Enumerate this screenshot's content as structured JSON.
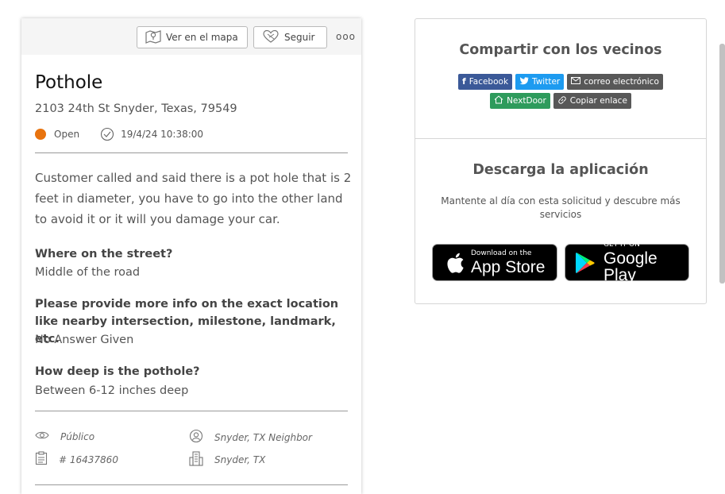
{
  "request": {
    "actions": {
      "map_label": "Ver en el mapa",
      "follow_label": "Seguir",
      "more_label": "ooo"
    },
    "title": "Pothole",
    "address": "2103 24th St Snyder, Texas, 79549",
    "status": {
      "label": "Open",
      "color": "#e8730e"
    },
    "timestamp": "19/4/24 10:38:00",
    "description": "Customer called and said there is a pot hole that is 2 feet in diameter, you have to go into the other land to avoid it or it will you damage your car.",
    "questions": [
      {
        "question": "Where on the street?",
        "answer": "Middle of the road"
      },
      {
        "question": "Please provide more info on the exact location like nearby intersection, milestone, landmark, etc.",
        "answer": "No Answer Given"
      },
      {
        "question": "How deep is the pothole?",
        "answer": "Between 6-12 inches deep"
      }
    ],
    "meta": {
      "visibility": "Público",
      "reporter": "Snyder, TX Neighbor",
      "id": "# 16437860",
      "agency": "Snyder, TX"
    }
  },
  "share": {
    "title": "Compartir con los vecinos",
    "facebook": "Facebook",
    "twitter": "Twitter",
    "email": "correo electrónico",
    "nextdoor": "NextDoor",
    "copy": "Copiar enlace"
  },
  "download": {
    "title": "Descarga la aplicación",
    "subtitle": "Mantente al día con esta solicitud y descubre más servicios",
    "appstore_small": "Download on the",
    "appstore_big": "App Store",
    "gplay_small": "GET IT ON",
    "gplay_big": "Google Play"
  }
}
